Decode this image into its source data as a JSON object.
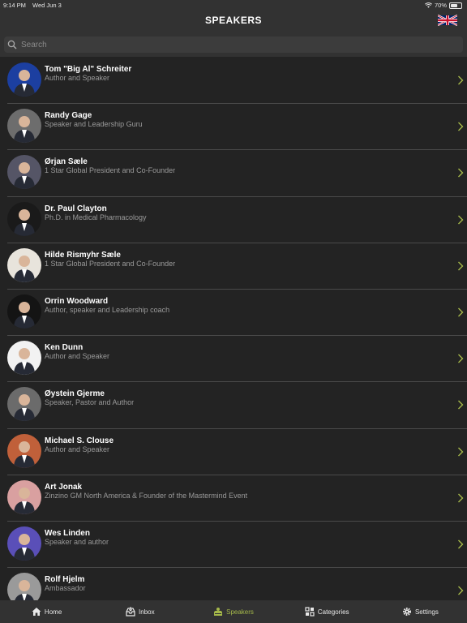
{
  "status": {
    "time": "9:14 PM",
    "date": "Wed Jun 3",
    "battery": "70%",
    "battery_level": 0.7
  },
  "nav": {
    "title": "SPEAKERS"
  },
  "search": {
    "placeholder": "Search"
  },
  "speakers": [
    {
      "name": "Tom \"Big Al\" Schreiter",
      "title": "Author and Speaker",
      "bg": "#1c3fa0"
    },
    {
      "name": "Randy Gage",
      "title": "Speaker and Leadership Guru",
      "bg": "#6d6d6d"
    },
    {
      "name": "Ørjan Sæle",
      "title": "1 Star Global President and Co-Founder",
      "bg": "#555566"
    },
    {
      "name": "Dr. Paul Clayton",
      "title": "Ph.D. in Medical Pharmacology",
      "bg": "#1a1a1a"
    },
    {
      "name": "Hilde Rismyhr Sæle",
      "title": "1 Star Global President and Co-Founder",
      "bg": "#e8e4dc"
    },
    {
      "name": "Orrin Woodward",
      "title": "Author, speaker and Leadership coach",
      "bg": "#141414"
    },
    {
      "name": "Ken Dunn",
      "title": "Author and Speaker",
      "bg": "#f2f2f2"
    },
    {
      "name": "Øystein Gjerme",
      "title": "Speaker, Pastor and Author",
      "bg": "#6b6b6b"
    },
    {
      "name": "Michael S. Clouse",
      "title": "Author and Speaker",
      "bg": "#c0603a"
    },
    {
      "name": "Art Jonak",
      "title": "Zinzino GM North America & Founder of the Mastermind Event",
      "bg": "#d9a0a0"
    },
    {
      "name": "Wes Linden",
      "title": "Speaker and author",
      "bg": "#5a4fb8"
    },
    {
      "name": "Rolf Hjelm",
      "title": "Ambassador",
      "bg": "#9a9a9a"
    }
  ],
  "tabs": [
    {
      "label": "Home",
      "icon": "home-icon"
    },
    {
      "label": "Inbox",
      "icon": "inbox-icon"
    },
    {
      "label": "Speakers",
      "icon": "speakers-icon",
      "active": true
    },
    {
      "label": "Categories",
      "icon": "categories-icon"
    },
    {
      "label": "Settings",
      "icon": "settings-icon"
    }
  ],
  "colors": {
    "accent": "#a5b84a",
    "chevron": "#a5b84a"
  }
}
